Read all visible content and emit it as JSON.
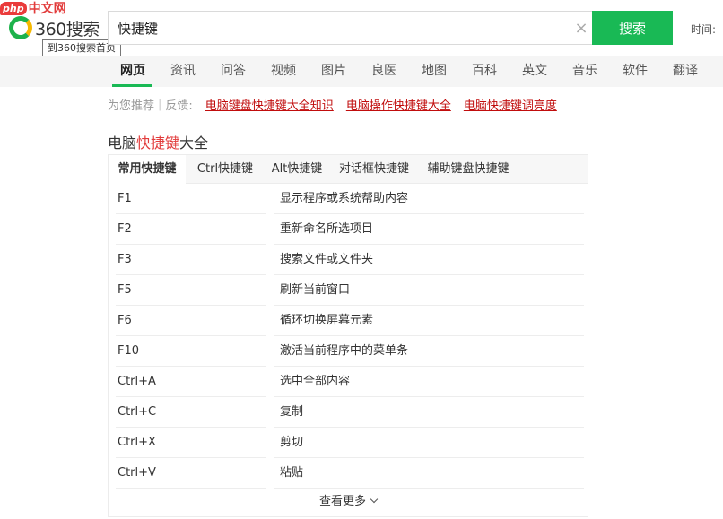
{
  "brand": {
    "php_badge": "php",
    "php_site": "中文网",
    "logo_text": "360搜索",
    "logo_tooltip": "到360搜索首页"
  },
  "search": {
    "query": "快捷键",
    "button_label": "搜索",
    "time_label": "时间:"
  },
  "nav": {
    "items": [
      {
        "label": "网页",
        "active": true
      },
      {
        "label": "资讯"
      },
      {
        "label": "问答"
      },
      {
        "label": "视频"
      },
      {
        "label": "图片"
      },
      {
        "label": "良医"
      },
      {
        "label": "地图"
      },
      {
        "label": "百科"
      },
      {
        "label": "英文"
      },
      {
        "label": "音乐"
      },
      {
        "label": "软件"
      },
      {
        "label": "翻译"
      }
    ]
  },
  "recommend": {
    "label": "为您推荐",
    "separator": "|",
    "feedback": "反馈:",
    "links": [
      "电脑键盘快捷键大全知识",
      "电脑操作快捷键大全",
      "电脑快捷键调亮度"
    ]
  },
  "card": {
    "title_prefix": "电脑",
    "title_highlight": "快捷键",
    "title_suffix": "大全",
    "tabs": [
      "常用快捷键",
      "Ctrl快捷键",
      "Alt快捷键",
      "对话框快捷键",
      "辅助键盘快捷键"
    ],
    "rows": [
      {
        "key": "F1",
        "desc": "显示程序或系统帮助内容"
      },
      {
        "key": "F2",
        "desc": "重新命名所选项目"
      },
      {
        "key": "F3",
        "desc": "搜索文件或文件夹"
      },
      {
        "key": "F5",
        "desc": "刷新当前窗口"
      },
      {
        "key": "F6",
        "desc": "循环切换屏幕元素"
      },
      {
        "key": "F10",
        "desc": "激活当前程序中的菜单条"
      },
      {
        "key": "Ctrl+A",
        "desc": "选中全部内容"
      },
      {
        "key": "Ctrl+C",
        "desc": "复制"
      },
      {
        "key": "Ctrl+X",
        "desc": "剪切"
      },
      {
        "key": "Ctrl+V",
        "desc": "粘贴"
      }
    ],
    "more_label": "查看更多"
  },
  "colors": {
    "accent": "#19b955",
    "highlight": "#e23c3c",
    "link": "#c10d0d"
  }
}
